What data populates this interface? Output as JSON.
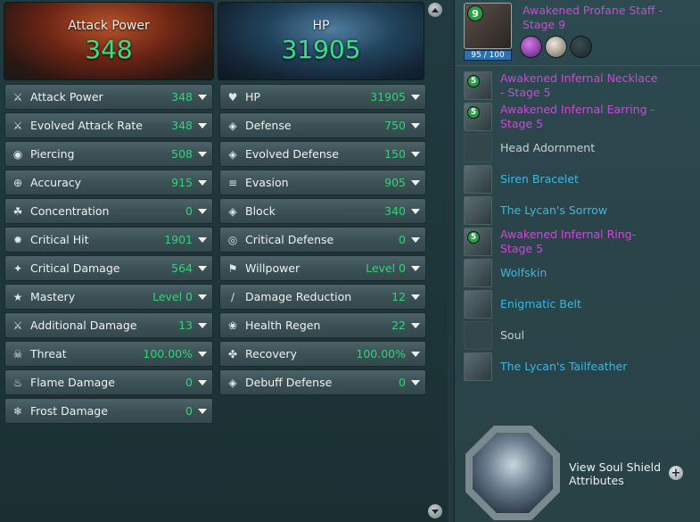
{
  "header": {
    "left": {
      "title": "Attack Power",
      "value": "348"
    },
    "right": {
      "title": "HP",
      "value": "31905"
    }
  },
  "offense": [
    {
      "label": "Attack Power",
      "value": "348",
      "icon": "sword-icon"
    },
    {
      "label": "Evolved Attack Rate",
      "value": "348",
      "icon": "crossed-swords-icon"
    },
    {
      "label": "Piercing",
      "value": "508",
      "icon": "pierce-icon"
    },
    {
      "label": "Accuracy",
      "value": "915",
      "icon": "crosshair-icon"
    },
    {
      "label": "Concentration",
      "value": "0",
      "icon": "concentration-icon"
    },
    {
      "label": "Critical Hit",
      "value": "1901",
      "icon": "burst-icon"
    },
    {
      "label": "Critical Damage",
      "value": "564",
      "icon": "crit-damage-icon"
    },
    {
      "label": "Mastery",
      "value": "Level 0",
      "icon": "mastery-icon"
    },
    {
      "label": "Additional Damage",
      "value": "13",
      "icon": "additional-damage-icon"
    },
    {
      "label": "Threat",
      "value": "100.00%",
      "icon": "skull-icon"
    },
    {
      "label": "Flame Damage",
      "value": "0",
      "icon": "flame-icon"
    },
    {
      "label": "Frost Damage",
      "value": "0",
      "icon": "snowflake-icon"
    }
  ],
  "defense": [
    {
      "label": "HP",
      "value": "31905",
      "icon": "heart-icon"
    },
    {
      "label": "Defense",
      "value": "750",
      "icon": "shield-icon"
    },
    {
      "label": "Evolved Defense",
      "value": "150",
      "icon": "evolved-shield-icon"
    },
    {
      "label": "Evasion",
      "value": "905",
      "icon": "evasion-icon"
    },
    {
      "label": "Block",
      "value": "340",
      "icon": "block-shield-icon"
    },
    {
      "label": "Critical Defense",
      "value": "0",
      "icon": "critical-defense-icon"
    },
    {
      "label": "Willpower",
      "value": "Level 0",
      "icon": "willpower-icon"
    },
    {
      "label": "Damage Reduction",
      "value": "12",
      "icon": "damage-reduction-icon"
    },
    {
      "label": "Health Regen",
      "value": "22",
      "icon": "sprout-icon"
    },
    {
      "label": "Recovery",
      "value": "100.00%",
      "icon": "recovery-icon"
    },
    {
      "label": "Debuff Defense",
      "value": "0",
      "icon": "debuff-shield-icon"
    }
  ],
  "weapon": {
    "level": "9",
    "name": "Awakened Profane Staff - Stage 9",
    "durability": "95 / 100",
    "gems": [
      "purple-gem-icon",
      "white-gem-icon",
      "empty-gem-slot-icon"
    ]
  },
  "equipment": [
    {
      "name": "Awakened Infernal Necklace - Stage 5",
      "badge": "5",
      "color": "#c84cd2",
      "icon": "necklace-icon"
    },
    {
      "name": "Awakened Infernal Earring - Stage 5",
      "badge": "5",
      "color": "#c84cd2",
      "icon": "earring-icon"
    },
    {
      "name": "Head Adornment",
      "badge": "",
      "color": "#c8d0d2",
      "icon": "head-adornment-icon"
    },
    {
      "name": "Siren Bracelet",
      "badge": "",
      "color": "#3fb6e0",
      "icon": "bracelet-icon"
    },
    {
      "name": "The Lycan's Sorrow",
      "badge": "",
      "color": "#3fb6e0",
      "icon": "lycan-sorrow-icon"
    },
    {
      "name": "Awakened Infernal Ring- Stage 5",
      "badge": "5",
      "color": "#c84cd2",
      "icon": "ring-icon"
    },
    {
      "name": "Wolfskin",
      "badge": "",
      "color": "#3fb6e0",
      "icon": "wolfskin-icon"
    },
    {
      "name": "Enigmatic Belt",
      "badge": "",
      "color": "#3fb6e0",
      "icon": "belt-icon"
    },
    {
      "name": "Soul",
      "badge": "",
      "color": "#c8d0d2",
      "icon": "soul-icon"
    },
    {
      "name": "The Lycan's Tailfeather",
      "badge": "",
      "color": "#3fb6e0",
      "icon": "tailfeather-icon"
    }
  ],
  "soul_shield": {
    "label": "View Soul Shield Attributes"
  },
  "colors": {
    "value_green": "#35d27a",
    "legendary_purple": "#c84cd2",
    "rare_blue": "#3fb6e0"
  }
}
